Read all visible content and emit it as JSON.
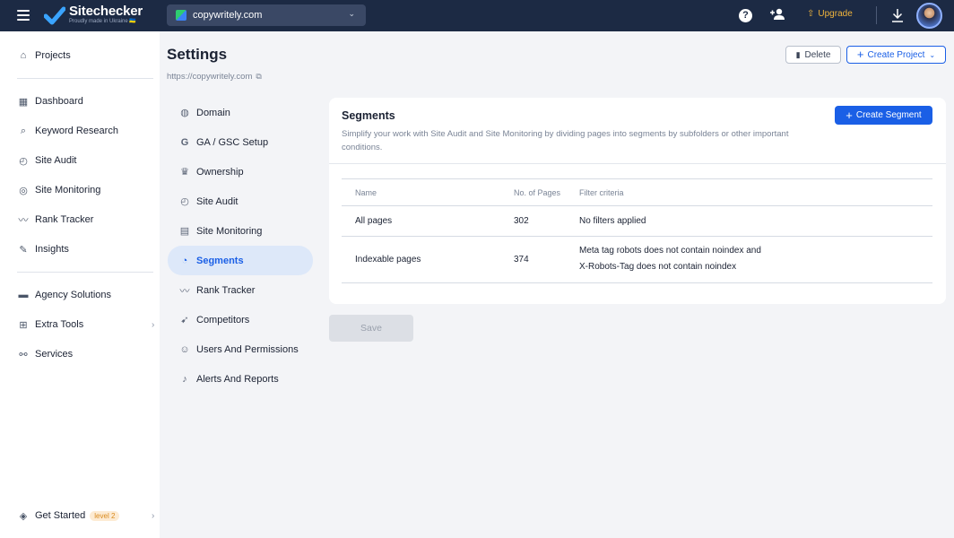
{
  "topbar": {
    "brand": "Sitechecker",
    "tagline": "Proudly made in Ukraine 🇺🇦",
    "project": "copywritely.com",
    "upgrade": "Upgrade"
  },
  "sidebar": {
    "projects": "Projects",
    "items": [
      {
        "label": "Dashboard",
        "icon": "dashboard-icon"
      },
      {
        "label": "Keyword Research",
        "icon": "keyword-icon"
      },
      {
        "label": "Site Audit",
        "icon": "audit-icon"
      },
      {
        "label": "Site Monitoring",
        "icon": "monitoring-icon"
      },
      {
        "label": "Rank Tracker",
        "icon": "rank-icon"
      },
      {
        "label": "Insights",
        "icon": "insights-icon"
      }
    ],
    "agency": "Agency Solutions",
    "extra_tools": "Extra Tools",
    "services": "Services",
    "get_started": "Get Started",
    "level": "level 2"
  },
  "page": {
    "title": "Settings",
    "url": "https://copywritely.com",
    "delete_label": "Delete",
    "create_project_label": "Create Project"
  },
  "settings_menu": [
    {
      "label": "Domain",
      "icon": "globe-icon"
    },
    {
      "label": "GA / GSC Setup",
      "icon": "google-icon"
    },
    {
      "label": "Ownership",
      "icon": "crown-icon"
    },
    {
      "label": "Site Audit",
      "icon": "audit-icon"
    },
    {
      "label": "Site Monitoring",
      "icon": "monitoring-icon"
    },
    {
      "label": "Segments",
      "icon": "pie-icon",
      "active": true
    },
    {
      "label": "Rank Tracker",
      "icon": "rank-icon"
    },
    {
      "label": "Competitors",
      "icon": "competitors-icon"
    },
    {
      "label": "Users And Permissions",
      "icon": "user-icon"
    },
    {
      "label": "Alerts And Reports",
      "icon": "bell-icon"
    }
  ],
  "segments": {
    "title": "Segments",
    "description": "Simplify your work with Site Audit and Site Monitoring by dividing pages into segments by subfolders or other important conditions.",
    "create_label": "Create Segment",
    "columns": [
      "Name",
      "No. of Pages",
      "Filter criteria"
    ],
    "rows": [
      {
        "name": "All pages",
        "pages": "302",
        "filter1": "No filters applied",
        "filter2": ""
      },
      {
        "name": "Indexable pages",
        "pages": "374",
        "filter1": "Meta tag robots does not contain noindex and",
        "filter2": "X-Robots-Tag does not contain noindex"
      }
    ],
    "save_label": "Save"
  },
  "colors": {
    "topbar": "#1c2a44",
    "accent": "#1a5fe6",
    "upgrade": "#f0b43c",
    "active_bg": "#dde8f9"
  }
}
